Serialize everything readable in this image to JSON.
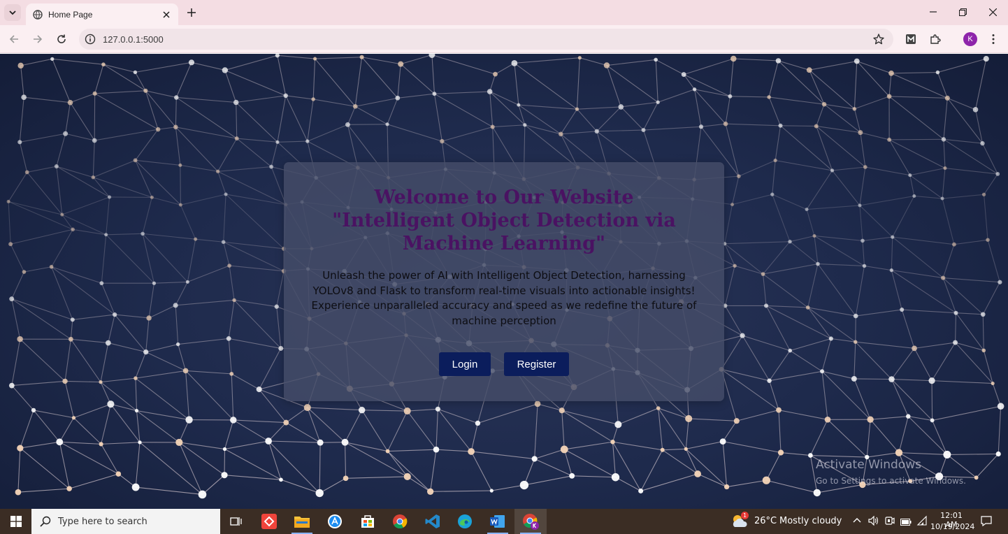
{
  "browser": {
    "tab_title": "Home Page",
    "url": "127.0.0.1:5000",
    "profile_initial": "K"
  },
  "page": {
    "heading_lines": [
      "Welcome to Our Website",
      "\"Intelligent Object Detection via",
      "Machine Learning\""
    ],
    "description_lines": [
      "Unleash the power of AI with Intelligent Object Detection, harnessing",
      "YOLOv8 and Flask to transform real-time visuals into actionable insights!",
      "Experience unparalleled accuracy and speed as we redefine the future of",
      "machine perception"
    ],
    "login_label": "Login",
    "register_label": "Register",
    "heading_color": "#4a1262",
    "button_color": "#0b1d5c"
  },
  "watermark": {
    "title": "Activate Windows",
    "subtitle": "Go to Settings to activate Windows."
  },
  "taskbar": {
    "search_placeholder": "Type here to search",
    "weather_badge": "1",
    "temperature": "26°C",
    "weather": "Mostly cloudy",
    "time": "12:01 AM",
    "date": "10/19/2024",
    "apps": [
      "task-view-icon",
      "anydesk-icon",
      "file-explorer-icon",
      "app-store-icon",
      "microsoft-store-icon",
      "chrome-icon",
      "vscode-icon",
      "edge-icon",
      "word-icon",
      "chrome-profile-icon"
    ]
  }
}
